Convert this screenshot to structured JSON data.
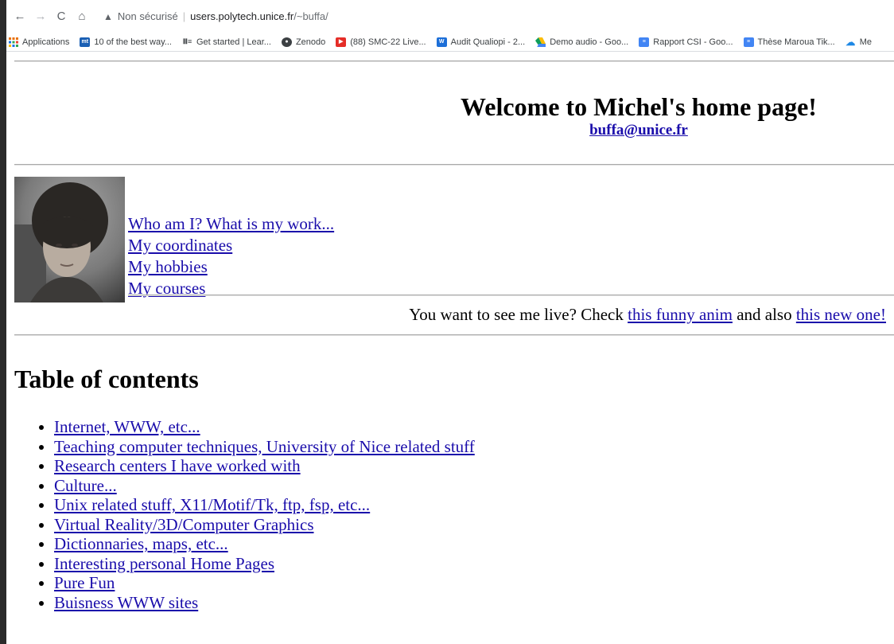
{
  "browser": {
    "nav": {
      "back": "←",
      "forward": "→",
      "reload": "C",
      "home": "⌂"
    },
    "security_label": "Non sécurisé",
    "url_host": "users.polytech.unice.fr",
    "url_path": "/~buffa/",
    "bookmarks": [
      {
        "label": "Applications",
        "icon_color": "#e8710a"
      },
      {
        "label": "10 of the best way...",
        "icon_color": "#1a5fb4"
      },
      {
        "label": "Get started | Lear...",
        "icon_color": "#3c4043"
      },
      {
        "label": "Zenodo",
        "icon_color": "#3c4043"
      },
      {
        "label": "(88) SMC-22 Live...",
        "icon_color": "#e52d27"
      },
      {
        "label": "Audit Qualiopi - 2...",
        "icon_color": "#1d6fd8"
      },
      {
        "label": "Demo audio - Goo...",
        "icon_color": "#0f9d58"
      },
      {
        "label": "Rapport CSI - Goo...",
        "icon_color": "#4285f4"
      },
      {
        "label": "Thèse Maroua Tik...",
        "icon_color": "#4285f4"
      },
      {
        "label": "Me",
        "icon_color": "#1e88e5"
      }
    ]
  },
  "page": {
    "title": "Welcome to Michel's home page!",
    "email": "buffa@unice.fr",
    "intro_links": [
      "Who am I? What is my work...",
      "My coordinates",
      "My hobbies",
      "My courses"
    ],
    "live": {
      "prefix": "You want to see me live? Check ",
      "link1": "this funny anim",
      "middle": " and also ",
      "link2": "this new one!"
    },
    "toc_title": "Table of contents",
    "toc": [
      "Internet, WWW, etc...",
      "Teaching computer techniques, University of Nice related stuff",
      "Research centers I have worked with",
      "Culture...",
      "Unix related stuff, X11/Motif/Tk, ftp, fsp, etc...",
      "Virtual Reality/3D/Computer Graphics",
      "Dictionnaries, maps, etc...",
      "Interesting personal Home Pages",
      "Pure Fun",
      "Buisness WWW sites"
    ]
  }
}
